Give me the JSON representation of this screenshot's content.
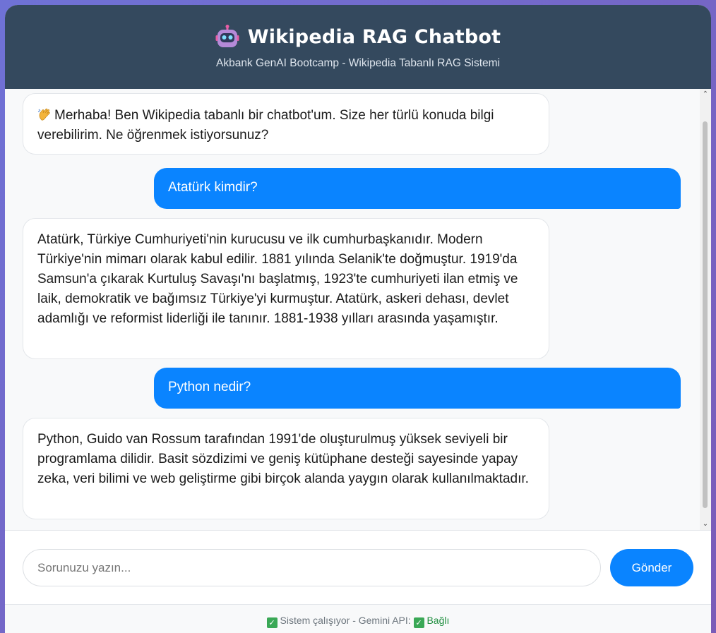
{
  "header": {
    "icon": "robot-icon",
    "title": "Wikipedia RAG Chatbot",
    "subtitle": "Akbank GenAI Bootcamp - Wikipedia Tabanlı RAG Sistemi"
  },
  "messages": [
    {
      "role": "bot",
      "icon": "waving-hand-icon",
      "text": "Merhaba! Ben Wikipedia tabanlı bir chatbot'um. Size her türlü konuda bilgi verebilirim. Ne öğrenmek istiyorsunuz?"
    },
    {
      "role": "user",
      "text": "Atatürk kimdir?"
    },
    {
      "role": "bot",
      "text": "Atatürk, Türkiye Cumhuriyeti'nin kurucusu ve ilk cumhurbaşkanıdır. Modern Türkiye'nin mimarı olarak kabul edilir. 1881 yılında Selanik'te doğmuştur. 1919'da Samsun'a çıkarak Kurtuluş Savaşı'nı başlatmış, 1923'te cumhuriyeti ilan etmiş ve laik, demokratik ve bağımsız Türkiye'yi kurmuştur. Atatürk, askeri dehası, devlet adamlığı ve reformist liderliği ile tanınır. 1881-1938 yılları arasında yaşamıştır."
    },
    {
      "role": "user",
      "text": "Python nedir?"
    },
    {
      "role": "bot",
      "text": "Python, Guido van Rossum tarafından 1991'de oluşturulmuş yüksek seviyeli bir programlama dilidir. Basit sözdizimi ve geniş kütüphane desteği sayesinde yapay zeka, veri bilimi ve web geliştirme gibi birçok alanda yaygın olarak kullanılmaktadır."
    }
  ],
  "input": {
    "placeholder": "Sorunuzu yazın...",
    "value": ""
  },
  "send_label": "Gönder",
  "status": {
    "system_text": "Sistem çalışıyor - Gemini API:",
    "api_state": "Bağlı",
    "ok_color": "#1e8e3e"
  },
  "colors": {
    "header_bg": "#34495e",
    "accent": "#0a84ff",
    "background_gradient": [
      "#6f72d6",
      "#7a5bb8"
    ]
  }
}
